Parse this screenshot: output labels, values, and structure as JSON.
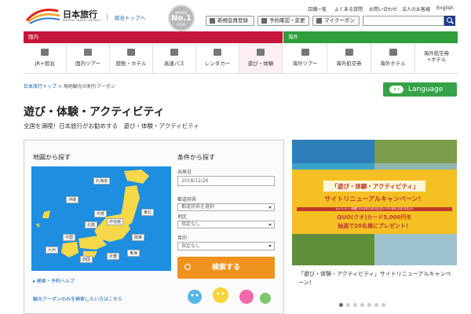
{
  "header": {
    "logo_text": "日本旅行",
    "logo_sub": "NIPPON TRAVEL AGENCY",
    "top_link": "総合トップへ",
    "badge": {
      "top": "顧客満足度",
      "main": "No.1",
      "bottom": "旅行会社"
    },
    "util_links": [
      "店舗一覧",
      "よくある質問",
      "お問い合わせ",
      "法人のお客様",
      "English"
    ],
    "buttons": {
      "register": "新規会員登録",
      "reserve": "予約確認・変更",
      "coupon": "マイクーポン"
    },
    "search_placeholder": ""
  },
  "nav": {
    "domestic_label": "国内",
    "overseas_label": "海外",
    "domestic_items": [
      "JR+宿泊",
      "国内ツアー",
      "旅館・ホテル",
      "高速バス",
      "レンタカー",
      "遊び・体験"
    ],
    "overseas_items": [
      "海外ツアー",
      "海外航空券",
      "海外ホテル",
      "海外航空券\n+ホテル"
    ],
    "active": "遊び・体験"
  },
  "breadcrumb": {
    "home": "日本旅行トップ",
    "current": "現地観光の割引クーポン",
    "sep": " > "
  },
  "language": {
    "badge": "あ A",
    "label": "Language"
  },
  "page": {
    "title": "遊び・体験・アクティビティ",
    "subtitle": "全国を満喫！日本旅行がお勧めする　遊び・体験・アクティビティ"
  },
  "search_panel": {
    "map_heading": "地図から探す",
    "regions": [
      "北海道",
      "沖縄",
      "東北",
      "中部",
      "中信越",
      "北陸",
      "関東",
      "中国",
      "九州",
      "四国",
      "近畿",
      "東海"
    ],
    "cond_heading": "条件から探す",
    "date_label": "出発日",
    "date_value": "2018/12/26",
    "pref_label": "都道府県",
    "pref_value": "都道府県を選択",
    "area_label": "地区",
    "area_value": "指定なし",
    "purpose_label": "目的",
    "purpose_value": "指定なし",
    "search_button": "検索する",
    "help_link": "検索・予約ヘルプ",
    "coupon_link": "観光クーポンのみを検索したい方はこちら"
  },
  "banner": {
    "headline1": "「遊び・体験・アクティビティ」",
    "headline2": "サイトリニューアルキャンペーン！",
    "period": "キャンペーン期間 2018年12月3日(月)〜2018年12月25日(火)",
    "prize1": "QUO(クオ)カード5,000円を",
    "prize2": "抽選で20名様にプレゼント！",
    "caption": "「遊び・体験・アクティビティ」サイトリニューアルキャンペーン！",
    "dot_count": 7,
    "active_dot": 0
  },
  "colors": {
    "domestic": "#c6153a",
    "overseas": "#2f9e3c",
    "search": "#f0921e",
    "map_sea": "#1e8fe0",
    "land": "#f6d84a"
  }
}
